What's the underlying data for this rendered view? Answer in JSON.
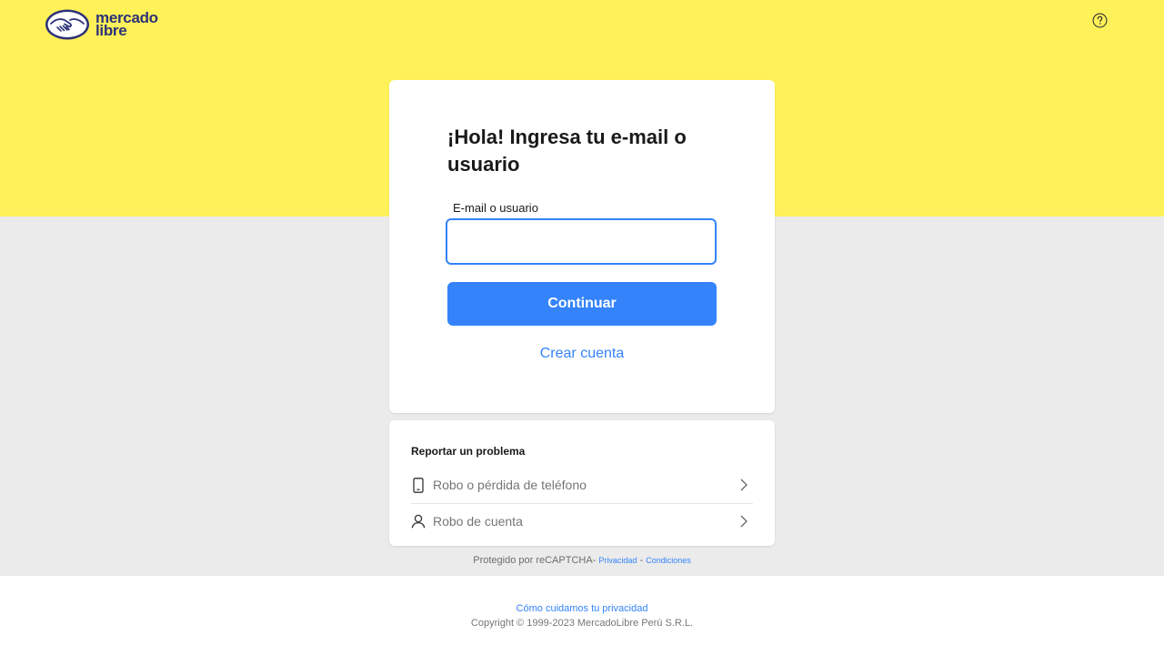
{
  "header": {
    "logo_line1": "mercado",
    "logo_line2": "libre",
    "help_icon": "question-circle-icon",
    "brand_color": "#fff159"
  },
  "login": {
    "title": "¡Hola! Ingresa tu e-mail o usuario",
    "field_label": "E-mail o usuario",
    "field_value": "",
    "continue_label": "Continuar",
    "create_account_label": "Crear cuenta",
    "accent_color": "#3483fa"
  },
  "report": {
    "title": "Reportar un problema",
    "items": [
      {
        "label": "Robo o pérdida de teléfono",
        "icon": "phone-icon"
      },
      {
        "label": "Robo de cuenta",
        "icon": "user-icon"
      }
    ]
  },
  "recaptcha": {
    "text": "Protegido por reCAPTCHA-",
    "privacy": "Privacidad",
    "separator": " - ",
    "conditions": "Condiciones"
  },
  "footer": {
    "privacy_link": "Cómo cuidamos tu privacidad",
    "copyright": "Copyright © 1999-2023 MercadoLibre Perú S.R.L."
  }
}
